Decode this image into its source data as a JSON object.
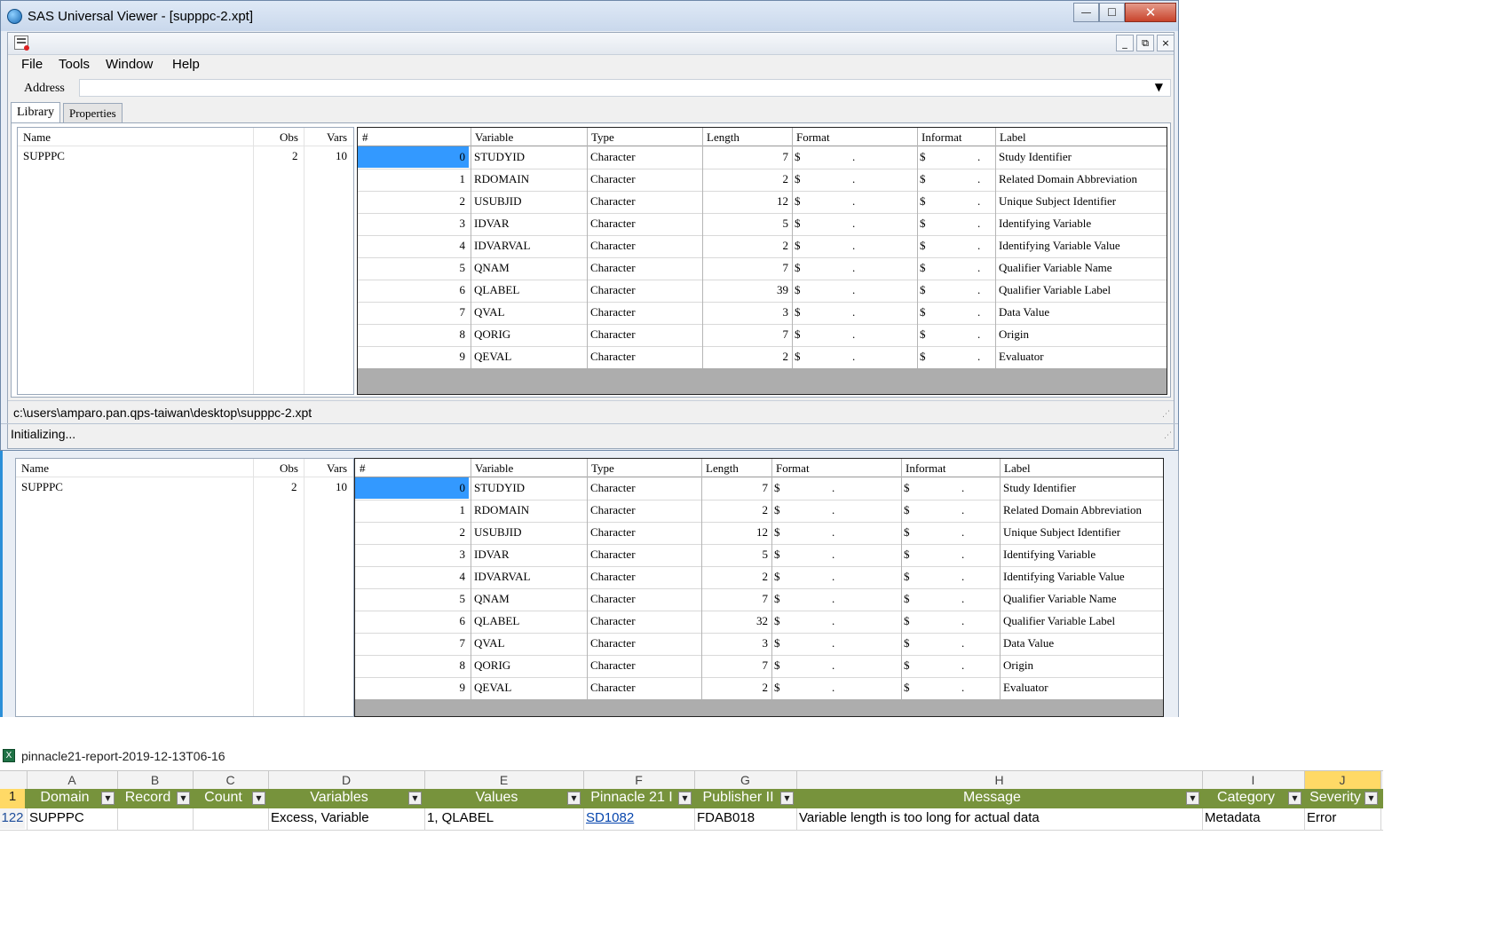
{
  "window": {
    "title": "SAS Universal Viewer - [supppc-2.xpt]",
    "min": "—",
    "max": "☐",
    "close": "✕"
  },
  "mdi": {
    "min": "_",
    "restore": "⧉",
    "close": "×"
  },
  "menu": [
    "File",
    "Tools",
    "Window",
    "Help"
  ],
  "address": {
    "label": "Address",
    "value": ""
  },
  "tabs": [
    "Library",
    "Properties"
  ],
  "library": {
    "headers": {
      "name": "Name",
      "obs": "Obs",
      "vars": "Vars"
    },
    "rows": [
      {
        "name": "SUPPPC",
        "obs": "2",
        "vars": "10"
      }
    ]
  },
  "grid": {
    "headers": {
      "num": "#",
      "variable": "Variable",
      "type": "Type",
      "length": "Length",
      "format": "Format",
      "informat": "Informat",
      "label": "Label"
    },
    "rows_top": [
      {
        "num": "0",
        "variable": "STUDYID",
        "type": "Character",
        "length": "7",
        "label": "Study Identifier"
      },
      {
        "num": "1",
        "variable": "RDOMAIN",
        "type": "Character",
        "length": "2",
        "label": "Related Domain Abbreviation"
      },
      {
        "num": "2",
        "variable": "USUBJID",
        "type": "Character",
        "length": "12",
        "label": "Unique Subject Identifier"
      },
      {
        "num": "3",
        "variable": "IDVAR",
        "type": "Character",
        "length": "5",
        "label": "Identifying Variable"
      },
      {
        "num": "4",
        "variable": "IDVARVAL",
        "type": "Character",
        "length": "2",
        "label": "Identifying Variable Value"
      },
      {
        "num": "5",
        "variable": "QNAM",
        "type": "Character",
        "length": "7",
        "label": "Qualifier Variable Name"
      },
      {
        "num": "6",
        "variable": "QLABEL",
        "type": "Character",
        "length": "39",
        "label": "Qualifier Variable Label"
      },
      {
        "num": "7",
        "variable": "QVAL",
        "type": "Character",
        "length": "3",
        "label": "Data Value"
      },
      {
        "num": "8",
        "variable": "QORIG",
        "type": "Character",
        "length": "7",
        "label": "Origin"
      },
      {
        "num": "9",
        "variable": "QEVAL",
        "type": "Character",
        "length": "2",
        "label": "Evaluator"
      }
    ],
    "rows_bottom": [
      {
        "num": "0",
        "variable": "STUDYID",
        "type": "Character",
        "length": "7",
        "label": "Study Identifier"
      },
      {
        "num": "1",
        "variable": "RDOMAIN",
        "type": "Character",
        "length": "2",
        "label": "Related Domain Abbreviation"
      },
      {
        "num": "2",
        "variable": "USUBJID",
        "type": "Character",
        "length": "12",
        "label": "Unique Subject Identifier"
      },
      {
        "num": "3",
        "variable": "IDVAR",
        "type": "Character",
        "length": "5",
        "label": "Identifying Variable"
      },
      {
        "num": "4",
        "variable": "IDVARVAL",
        "type": "Character",
        "length": "2",
        "label": "Identifying Variable Value"
      },
      {
        "num": "5",
        "variable": "QNAM",
        "type": "Character",
        "length": "7",
        "label": "Qualifier Variable Name"
      },
      {
        "num": "6",
        "variable": "QLABEL",
        "type": "Character",
        "length": "32",
        "label": "Qualifier Variable Label"
      },
      {
        "num": "7",
        "variable": "QVAL",
        "type": "Character",
        "length": "3",
        "label": "Data Value"
      },
      {
        "num": "8",
        "variable": "QORIG",
        "type": "Character",
        "length": "7",
        "label": "Origin"
      },
      {
        "num": "9",
        "variable": "QEVAL",
        "type": "Character",
        "length": "2",
        "label": "Evaluator"
      }
    ],
    "format_value": "$",
    "dot": "."
  },
  "status": {
    "path": "c:\\users\\amparo.pan.qps-taiwan\\desktop\\supppc-2.xpt",
    "message": "Initializing..."
  },
  "excel": {
    "title": "pinnacle21-report-2019-12-13T06-16",
    "icon": "X",
    "columns": [
      "A",
      "B",
      "C",
      "D",
      "E",
      "F",
      "G",
      "H",
      "I",
      "J"
    ],
    "header_row_num": "1",
    "headers": [
      "Domain",
      "Record",
      "Count",
      "Variables",
      "Values",
      "Pinnacle 21 I",
      "Publisher II",
      "Message",
      "Category",
      "Severity"
    ],
    "row": {
      "num": "122",
      "domain": "SUPPPC",
      "variables": "Excess, Variable",
      "values": "1, QLABEL",
      "pinnacle_id": "SD1082",
      "publisher_id": "FDAB018",
      "message": "Variable length is too long for actual data",
      "category": "Metadata",
      "severity": "Error"
    },
    "filter_arrow": "▼",
    "header_color": "#77933c"
  },
  "colors": {
    "selected_cell": "#3399ff",
    "grid_gray": "#adadad",
    "link": "#0645ad"
  }
}
